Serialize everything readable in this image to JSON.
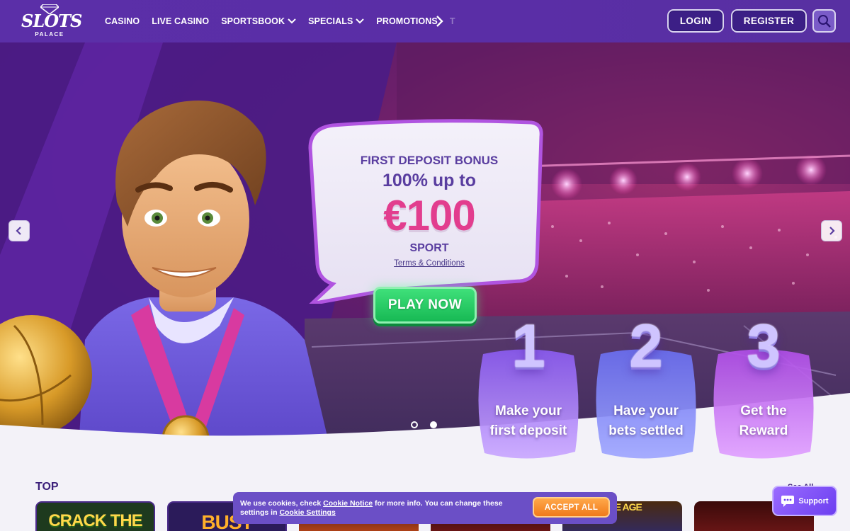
{
  "brand": {
    "logo_main": "SLOTS",
    "logo_sub": "PALACE"
  },
  "nav": {
    "items": [
      {
        "label": "CASINO",
        "has_dropdown": false
      },
      {
        "label": "LIVE CASINO",
        "has_dropdown": false
      },
      {
        "label": "SPORTSBOOK",
        "has_dropdown": true
      },
      {
        "label": "SPECIALS",
        "has_dropdown": true
      },
      {
        "label": "PROMOTIONS",
        "has_dropdown": false
      }
    ],
    "overflow_label": "T"
  },
  "header": {
    "login_label": "LOGIN",
    "register_label": "REGISTER",
    "search_icon": "search-icon"
  },
  "hero": {
    "bonus_title": "FIRST DEPOSIT BONUS",
    "bonus_sub": "100% up to",
    "bonus_amount": "€100",
    "bonus_product": "SPORT",
    "terms_label": "Terms & Conditions",
    "cta_label": "PLAY NOW",
    "steps": [
      {
        "number": "1",
        "label_line1": "Make your",
        "label_line2": "first deposit"
      },
      {
        "number": "2",
        "label_line1": "Have your",
        "label_line2": "bets settled"
      },
      {
        "number": "3",
        "label_line1": "Get the",
        "label_line2": "Reward"
      }
    ],
    "slides_total": 2,
    "active_slide": 1
  },
  "top_section": {
    "title": "TOP",
    "see_all_label": "See All",
    "games": [
      {
        "title": "CRACK THE",
        "color": "#2a7a2a"
      },
      {
        "title": "BUST",
        "color": "#2b1b5a"
      },
      {
        "title": "",
        "color": "#e8561a"
      },
      {
        "title": "",
        "color": "#8a1a1a"
      },
      {
        "title": "THE AGE",
        "color": "#2a2a7a"
      },
      {
        "title": "",
        "color": "#7a1a1a"
      }
    ]
  },
  "cookie": {
    "text_before_link1": "We use cookies, check ",
    "link1": "Cookie Notice",
    "text_middle": " for more info. You can change these settings in ",
    "link2": "Cookie Settings",
    "accept_label": "ACCEPT ALL"
  },
  "support": {
    "label": "Support"
  },
  "colors": {
    "header_bg": "#5a2ea6",
    "accent_pink": "#e23d8e",
    "cta_green": "#22c55e",
    "accept_orange": "#f59a38",
    "cookie_bg": "#6b4fc6"
  }
}
